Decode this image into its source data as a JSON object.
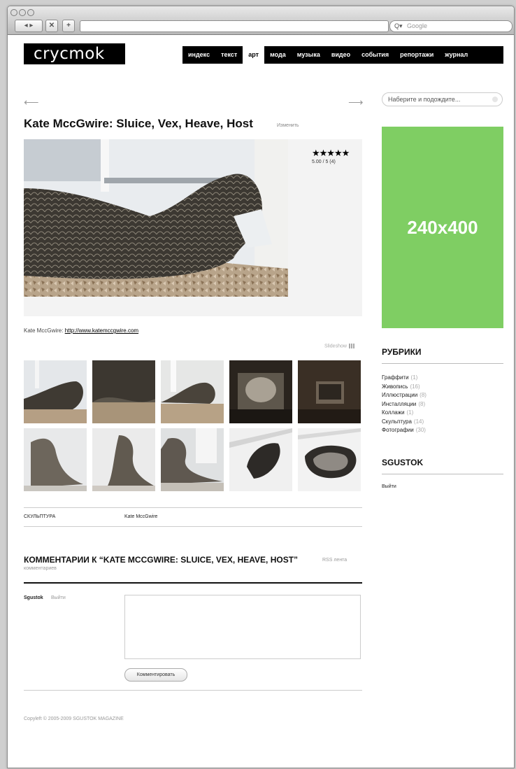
{
  "browser": {
    "back_forward": "◂ ▸",
    "stop": "✕",
    "add": "+",
    "search_prefix": "Q▾",
    "search_placeholder": "Google"
  },
  "site": {
    "logo": "crycmok",
    "nav": [
      {
        "label": "индекс",
        "active": false
      },
      {
        "label": "текст",
        "active": false
      },
      {
        "label": "арт",
        "active": true
      },
      {
        "label": "мода",
        "active": false
      },
      {
        "label": "музыка",
        "active": false
      },
      {
        "label": "видео",
        "active": false
      },
      {
        "label": "события",
        "active": false
      },
      {
        "label": "репортажи",
        "active": false
      },
      {
        "label": "журнал",
        "active": false
      }
    ]
  },
  "post": {
    "prev_arrow": "⟵",
    "next_arrow": "⟶",
    "title": "Kate MccGwire: Sluice, Vex, Heave, Host",
    "edit_label": "Изменить",
    "rating_stars": "★★★★★",
    "rating_text": "5.00 / 5 (4)",
    "caption_prefix": "Kate MccGwire:",
    "caption_link": "http://www.katemccgwire.com",
    "gallery_label": "Slideshow",
    "category": "СКУЛЬПТУРА",
    "tag": "Kate MccGwire"
  },
  "comments": {
    "title": "КОММЕНТАРИИ К “KATE MCCGWIRE: SLUICE, VEX, HEAVE, HOST”",
    "rss_part1": "RSS лента",
    "rss_part2": "комментариев",
    "user": "Sgustok",
    "logout": "Выйти",
    "submit": "Комментировать"
  },
  "footer": {
    "copyright": "Copyleft © 2005-2009 SGUSTOK MAGAZINE"
  },
  "sidebar": {
    "search_placeholder": "Наберите и подождите...",
    "banner": "240x400",
    "rubrics_heading": "РУБРИКИ",
    "rubrics": [
      {
        "name": "Граффити",
        "count": "(1)"
      },
      {
        "name": "Живопись",
        "count": "(16)"
      },
      {
        "name": "Иллюстрации",
        "count": "(8)"
      },
      {
        "name": "Инсталляции",
        "count": "(8)"
      },
      {
        "name": "Коллажи",
        "count": "(1)"
      },
      {
        "name": "Скульптура",
        "count": "(14)"
      },
      {
        "name": "Фотографии",
        "count": "(30)"
      }
    ],
    "user_heading": "SGUSTOK",
    "logout": "Выйти"
  },
  "colors": {
    "banner": "#7fce63",
    "nav_bg": "#000000"
  }
}
